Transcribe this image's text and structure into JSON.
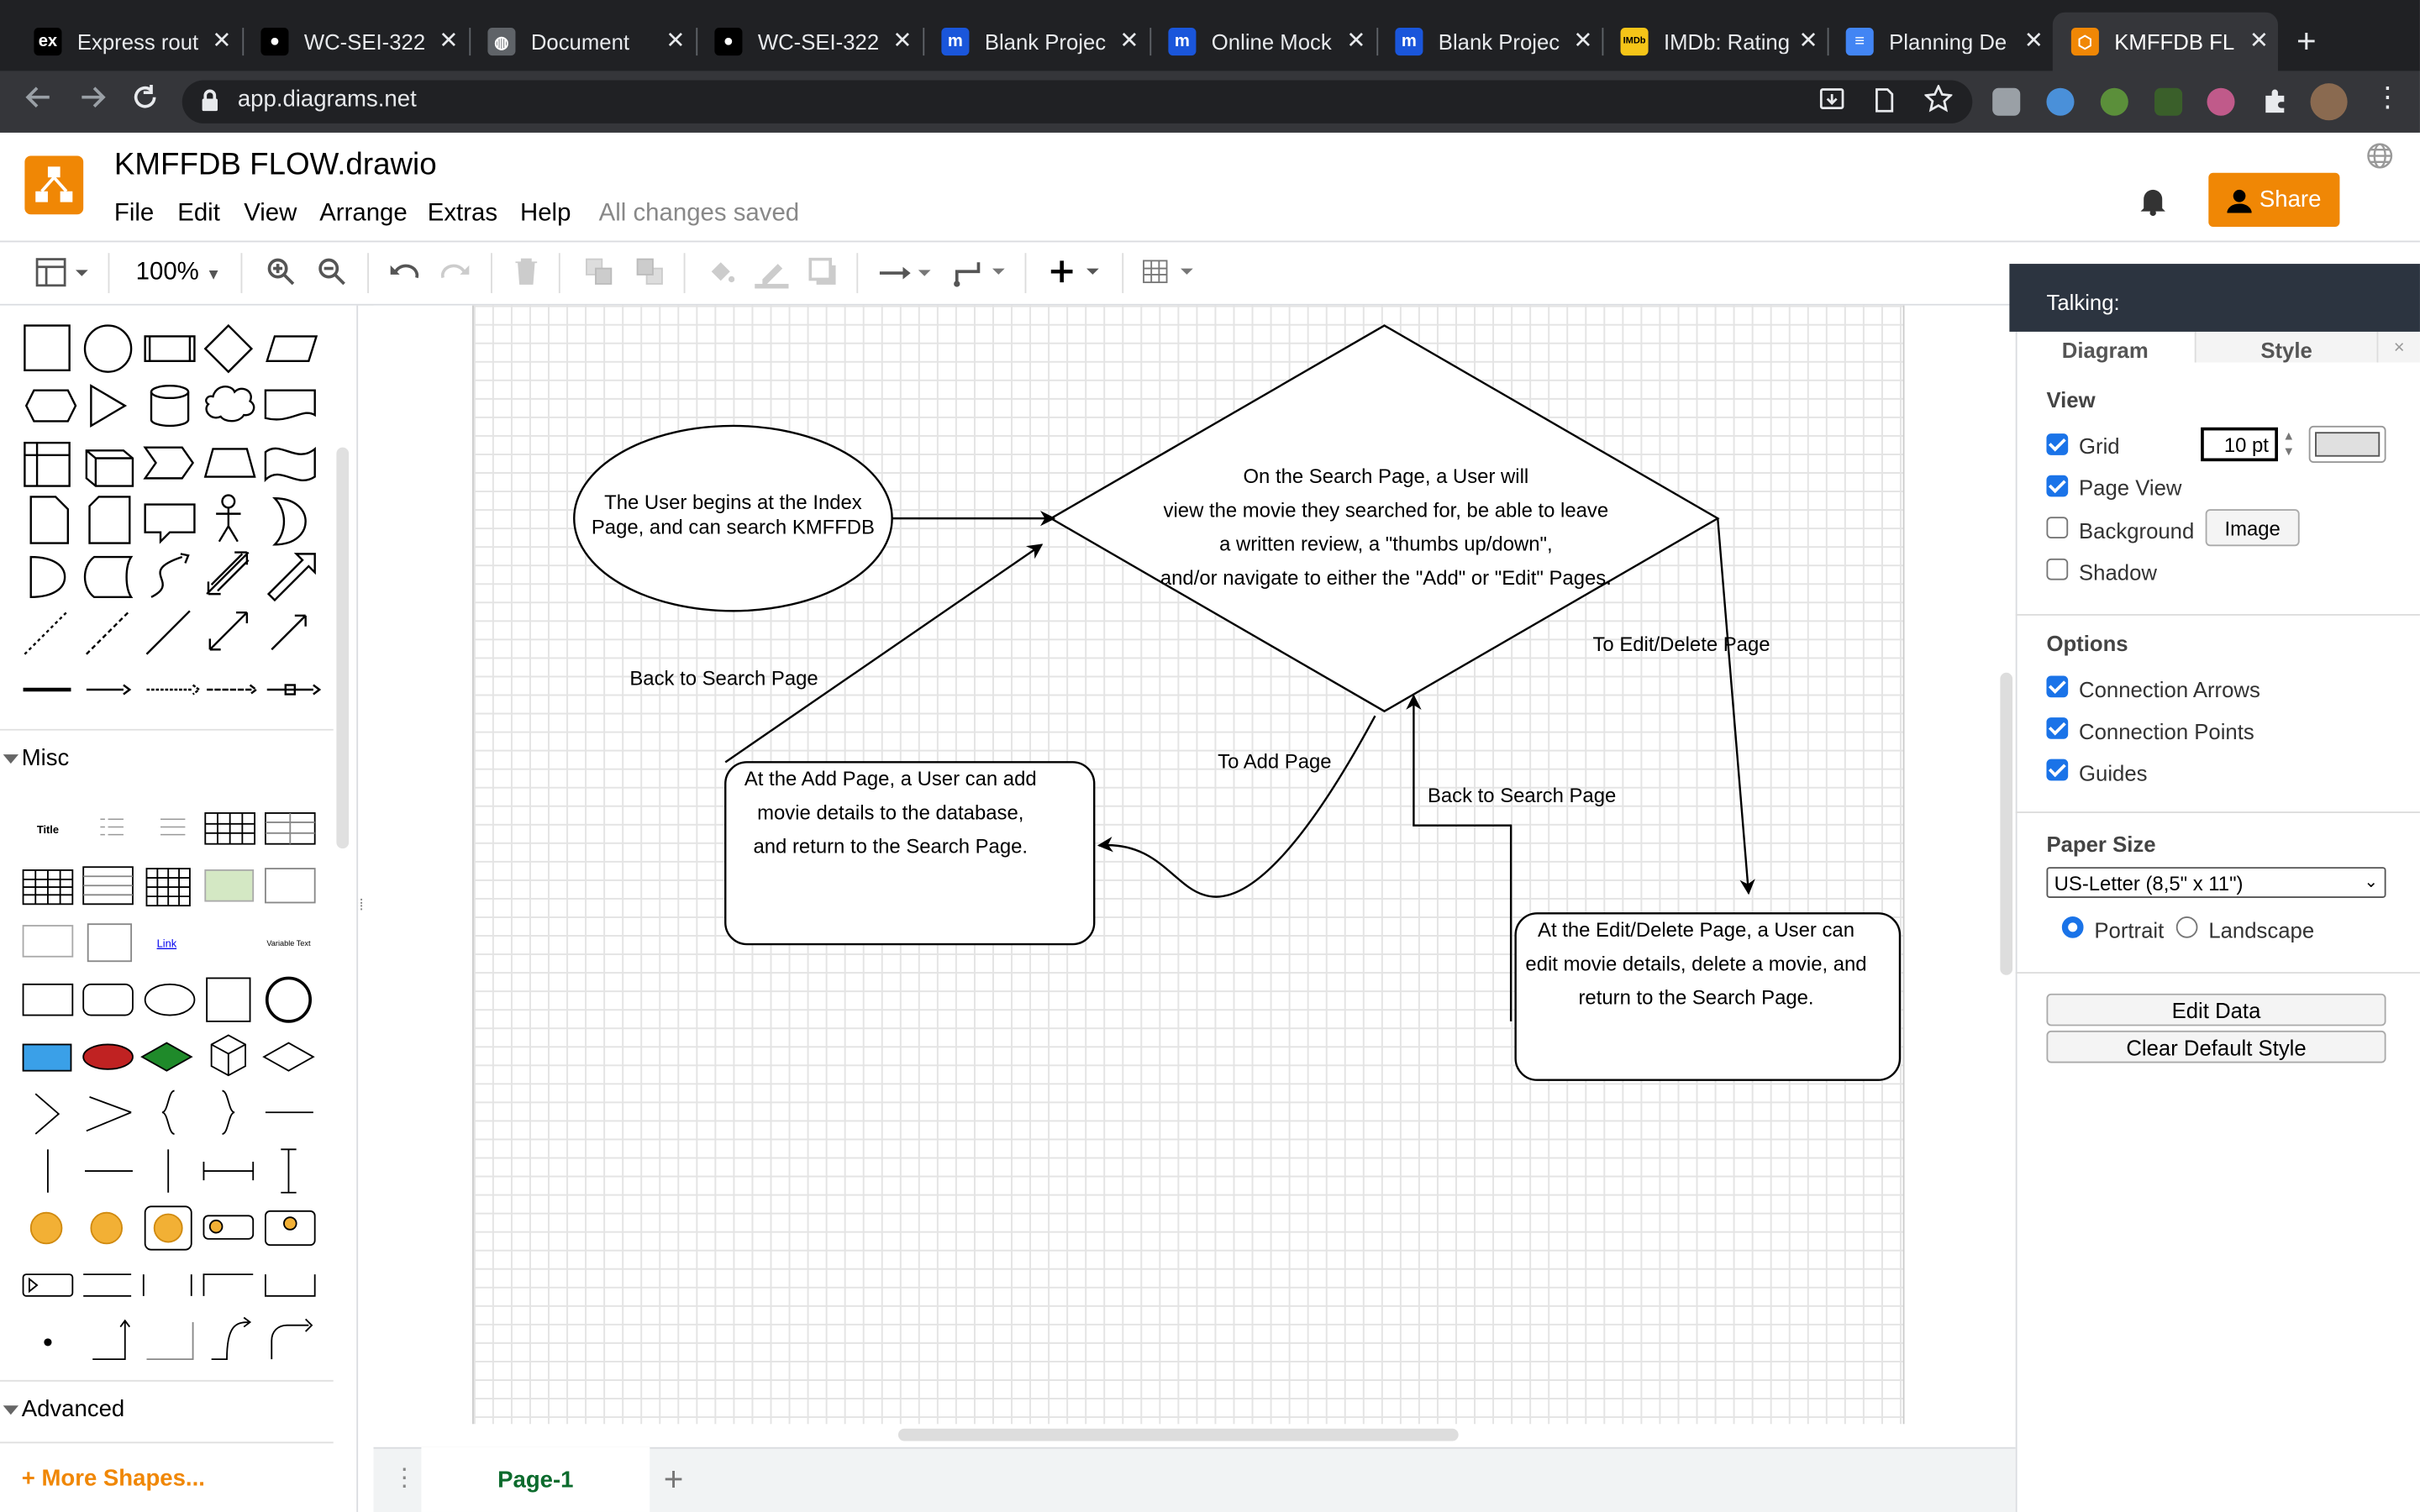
{
  "browser": {
    "tabs": [
      {
        "title": "Express rout",
        "icon": "express-icon",
        "color": "#000000"
      },
      {
        "title": "WC-SEI-322",
        "icon": "github-icon",
        "color": "#000000"
      },
      {
        "title": "Document",
        "icon": "globe-icon",
        "color": "#5f6368"
      },
      {
        "title": "WC-SEI-322",
        "icon": "github-icon",
        "color": "#000000"
      },
      {
        "title": "Blank Projec",
        "icon": "moqups-icon",
        "color": "#1a56db"
      },
      {
        "title": "Online Mock",
        "icon": "moqups-icon",
        "color": "#1a56db"
      },
      {
        "title": "Blank Projec",
        "icon": "moqups-icon",
        "color": "#1a56db"
      },
      {
        "title": "IMDb: Rating",
        "icon": "imdb-icon",
        "color": "#f5c518"
      },
      {
        "title": "Planning De",
        "icon": "google-docs-icon",
        "color": "#4285f4"
      },
      {
        "title": "KMFFDB FL",
        "icon": "drawio-icon",
        "color": "#f08705"
      }
    ],
    "url": "app.diagrams.net"
  },
  "app": {
    "doc_title": "KMFFDB FLOW.drawio",
    "menu": [
      "File",
      "Edit",
      "View",
      "Arrange",
      "Extras",
      "Help"
    ],
    "save_status": "All changes saved",
    "share_label": "Share",
    "zoom": "100%",
    "brand_color": "#f08705"
  },
  "sidebar": {
    "misc_label": "Misc",
    "advanced_label": "Advanced",
    "more_shapes": "+ More Shapes...",
    "misc_title_sample": "Title",
    "misc_link_sample": "Link",
    "misc_vartext_sample": "Variable Text"
  },
  "diagram": {
    "start_text": "The User begins at the Index Page, and can search KMFFDB",
    "search_lines": [
      "On the Search Page, a User will",
      "view the movie they searched for, be able to leave",
      "a written review, a \"thumbs up/down\",",
      "and/or navigate to either the \"Add\" or \"Edit\" Pages."
    ],
    "add_lines": [
      "At the Add Page, a User can add",
      "movie details to the database,",
      "and return to the Search Page."
    ],
    "edit_lines": [
      "At the Edit/Delete Page, a User can",
      "edit movie details, delete a movie, and",
      "return to the Search Page."
    ],
    "labels": {
      "back_left": "Back to Search Page",
      "to_add": "To Add Page",
      "back_right": "Back to Search Page",
      "to_edit": "To Edit/Delete Page"
    }
  },
  "page_tab": "Page-1",
  "format_panel": {
    "talking": "Talking:",
    "tabs": [
      "Diagram",
      "Style"
    ],
    "view_heading": "View",
    "grid_label": "Grid",
    "grid_size": "10 pt",
    "grid_checked": true,
    "page_view_label": "Page View",
    "page_view_checked": true,
    "background_label": "Background",
    "background_checked": false,
    "image_button": "Image",
    "shadow_label": "Shadow",
    "shadow_checked": false,
    "options_heading": "Options",
    "connection_arrows": "Connection Arrows",
    "connection_points": "Connection Points",
    "guides": "Guides",
    "paper_heading": "Paper Size",
    "paper_size": "US-Letter (8,5\" x 11\")",
    "portrait": "Portrait",
    "landscape": "Landscape",
    "edit_data": "Edit Data",
    "clear_style": "Clear Default Style"
  }
}
